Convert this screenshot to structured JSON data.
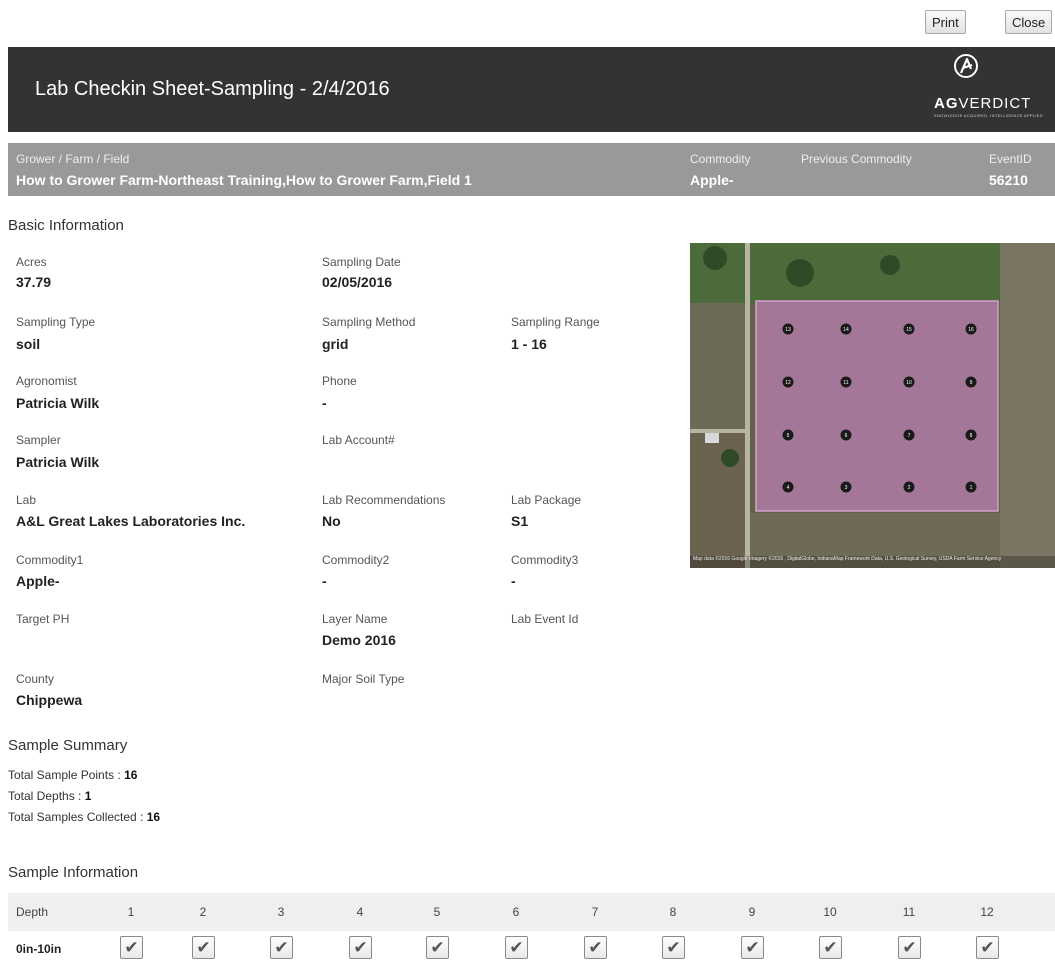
{
  "toolbar": {
    "print_label": "Print",
    "close_label": "Close"
  },
  "header": {
    "title": "Lab Checkin Sheet-Sampling - 2/4/2016",
    "logo_bold": "AG",
    "logo_light": "VERDICT",
    "logo_tag": "KNOWLEDGE ACQUIRED, INTELLIGENCE APPLIED"
  },
  "infobar": {
    "grower_label": "Grower / Farm / Field",
    "grower_value": "How to Grower Farm-Northeast Training,How to Grower Farm,Field 1",
    "commodity_label": "Commodity",
    "commodity_value": "Apple-",
    "prev_commodity_label": "Previous Commodity",
    "prev_commodity_value": "",
    "event_label": "EventID",
    "event_value": "56210"
  },
  "basic": {
    "heading": "Basic Information",
    "acres_label": "Acres",
    "acres_value": "37.79",
    "sampling_date_label": "Sampling Date",
    "sampling_date_value": "02/05/2016",
    "sampling_type_label": "Sampling Type",
    "sampling_type_value": "soil",
    "sampling_method_label": "Sampling Method",
    "sampling_method_value": "grid",
    "sampling_range_label": "Sampling Range",
    "sampling_range_value": "1 - 16",
    "agronomist_label": "Agronomist",
    "agronomist_value": "Patricia Wilk",
    "phone_label": "Phone",
    "phone_value": "-",
    "sampler_label": "Sampler",
    "sampler_value": "Patricia Wilk",
    "lab_account_label": "Lab Account#",
    "lab_account_value": "",
    "lab_label": "Lab",
    "lab_value": "A&L Great Lakes Laboratories Inc.",
    "lab_recs_label": "Lab Recommendations",
    "lab_recs_value": "No",
    "lab_package_label": "Lab Package",
    "lab_package_value": "S1",
    "commodity1_label": "Commodity1",
    "commodity1_value": "Apple-",
    "commodity2_label": "Commodity2",
    "commodity2_value": "-",
    "commodity3_label": "Commodity3",
    "commodity3_value": "-",
    "target_ph_label": "Target PH",
    "target_ph_value": "",
    "layer_name_label": "Layer Name",
    "layer_name_value": "Demo 2016",
    "lab_event_label": "Lab Event Id",
    "lab_event_value": "",
    "county_label": "County",
    "county_value": "Chippewa",
    "major_soil_label": "Major Soil Type",
    "major_soil_value": ""
  },
  "map": {
    "attribution": "Map data ©2016 Google  Imagery ©2016 , DigitalGlobe, IndianaMap Framework Data, U.S. Geological Survey, USDA Farm Service Agency",
    "field_color": "#b07aa8",
    "point_labels": [
      "13",
      "14",
      "15",
      "16",
      "12",
      "11",
      "10",
      "9",
      "5",
      "6",
      "7",
      "8",
      "4",
      "3",
      "2",
      "1"
    ]
  },
  "summary": {
    "heading": "Sample Summary",
    "points_label": "Total Sample Points : ",
    "points_value": "16",
    "depths_label": "Total Depths : ",
    "depths_value": "1",
    "collected_label": "Total Samples Collected : ",
    "collected_value": "16"
  },
  "sample_info": {
    "heading": "Sample Information",
    "depth_header": "Depth",
    "columns": [
      "1",
      "2",
      "3",
      "4",
      "5",
      "6",
      "7",
      "8",
      "9",
      "10",
      "11",
      "12"
    ],
    "rows": [
      {
        "depth": "0in-10in",
        "checked": [
          true,
          true,
          true,
          true,
          true,
          true,
          true,
          true,
          true,
          true,
          true,
          true
        ]
      }
    ]
  }
}
